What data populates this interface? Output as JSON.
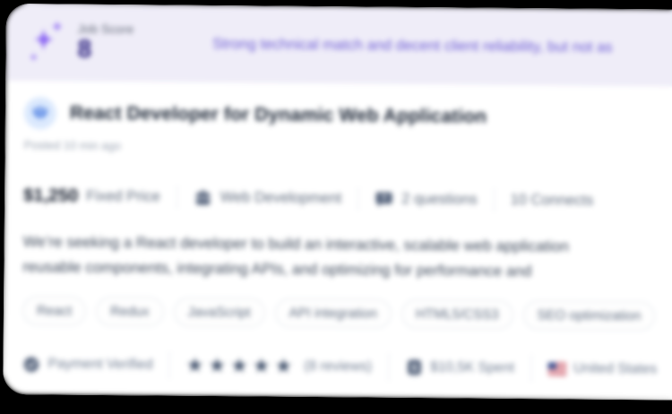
{
  "banner": {
    "job_score_label": "Job Score",
    "job_score_value": "8",
    "summary": "Strong technical match and decent client reliability, but not as",
    "background_color": "#efedf8",
    "accent_text_color": "#6d5cd5",
    "score_color": "#2c2180"
  },
  "job": {
    "title": "React Developer for Dynamic Web Application",
    "posted": "Posted 10 min ago"
  },
  "stats": {
    "price": "$1,250",
    "price_type": "Fixed Price",
    "category": "Web Development",
    "questions": "2 questions",
    "connects": "10 Connects"
  },
  "description": {
    "line1": "We’re seeking a React developer to build an interactive, scalable web application",
    "line2": "reusable components, integrating APIs, and optimizing for performance and"
  },
  "tags": [
    "React",
    "Redux",
    "JavaScript",
    "API integration",
    "HTML5/CSS3",
    "SEO optimization"
  ],
  "client": {
    "payment_verified": "Payment Verified",
    "rating_stars": 5,
    "reviews": "(8 reviews)",
    "spent": "$10,5K Spent",
    "country": "United States"
  },
  "icons": {
    "star": "★",
    "sparkles": "sparkles-icon",
    "gem": "gem-icon",
    "briefcase": "briefcase-icon",
    "question_bubble": "question-bubble-icon",
    "verified_badge": "verified-badge-icon",
    "banknote": "banknote-icon",
    "us_flag": "us-flag-icon"
  },
  "colors": {
    "slate_icon": "#54627b",
    "gem_blue": "#2f6bdf",
    "gem_circle": "#dbe9fd",
    "star_color": "#41516b",
    "tag_border": "#e3e8ee"
  }
}
